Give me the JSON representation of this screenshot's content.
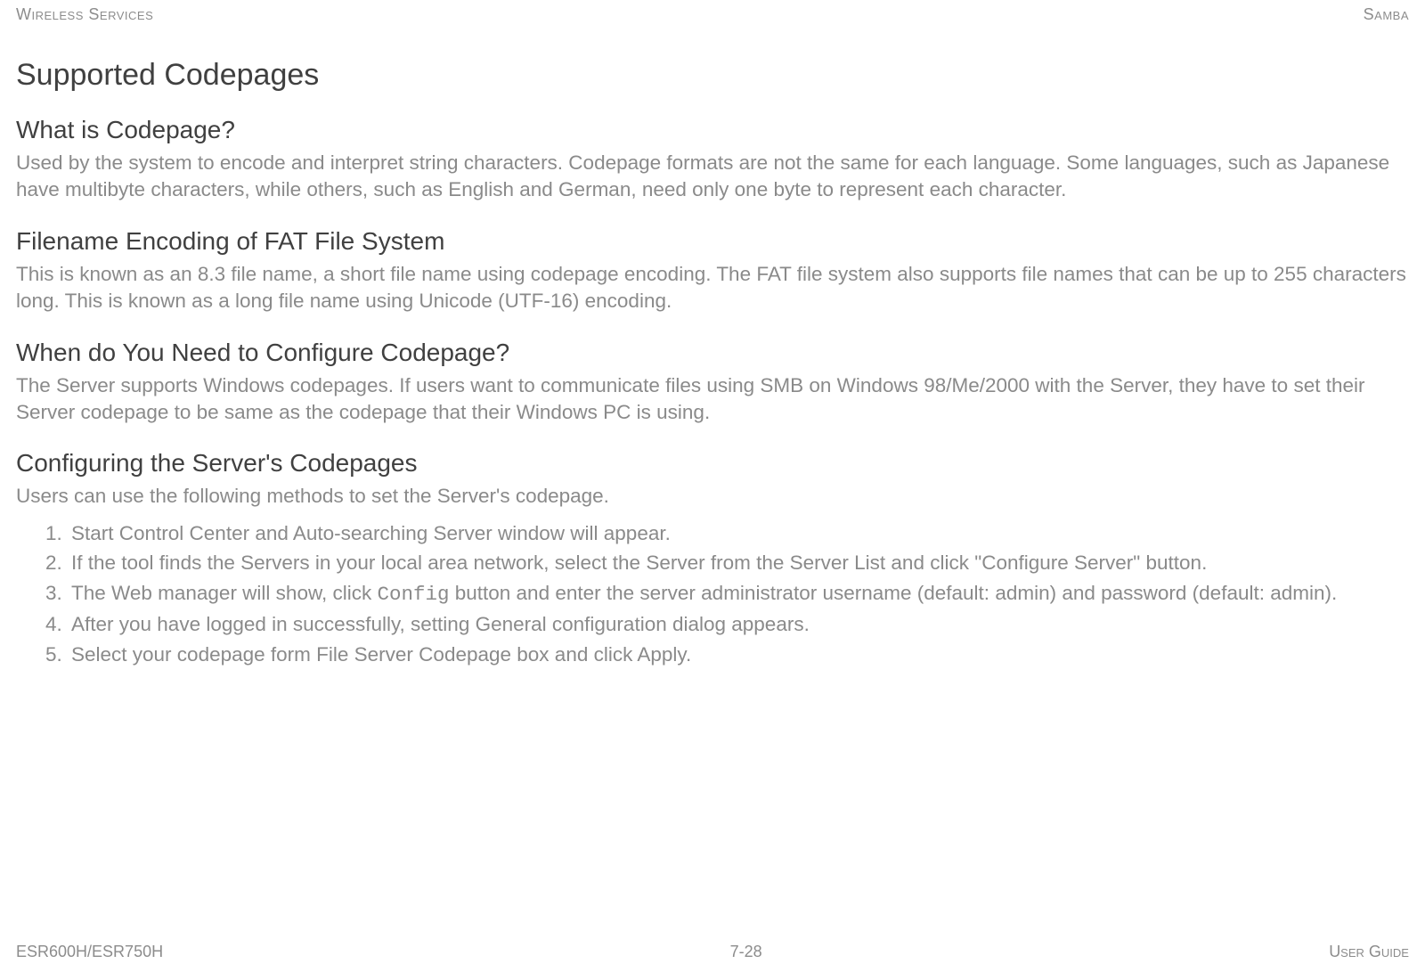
{
  "header": {
    "left": "Wireless Services",
    "right": "Samba"
  },
  "footer": {
    "left": "ESR600H/ESR750H",
    "center": "7-28",
    "right": "User Guide"
  },
  "h1": "Supported Codepages",
  "sections": {
    "s1": {
      "title": "What is Codepage?",
      "body": "Used by the system to encode and interpret string characters. Codepage formats are not the same for each language. Some languages, such as Japanese have multibyte characters, while others, such as English and German, need only one byte to represent each character."
    },
    "s2": {
      "title": "Filename Encoding of FAT File System",
      "body": "This is known as an 8.3 file name, a short file name using codepage encoding. The FAT file system also supports file names that can be up to 255 characters long. This is known as a long file name using Unicode (UTF-16) encoding."
    },
    "s3": {
      "title": "When do You Need to Configure Codepage?",
      "body": "The Server supports Windows codepages. If users want to communicate files using SMB on Windows 98/Me/2000 with the Server, they have to set their Server codepage to be same as the codepage that their Windows PC is using."
    },
    "s4": {
      "title": "Configuring the Server's Codepages",
      "intro": "Users can use the following methods to set the Server's codepage.",
      "steps": {
        "i1": "Start Control Center and Auto-searching Server window will appear.",
        "i2": "If the tool finds the Servers in your local area network, select the Server from the Server List and click \"Configure Server\" button.",
        "i3a": "The Web manager will show, click ",
        "i3code": "Config",
        "i3b": " button and enter the server administrator username (default: admin) and password (default: admin).",
        "i4": "After you have logged in successfully, setting General configuration dialog appears.",
        "i5": "Select your codepage form File Server Codepage box and click Apply."
      }
    }
  }
}
